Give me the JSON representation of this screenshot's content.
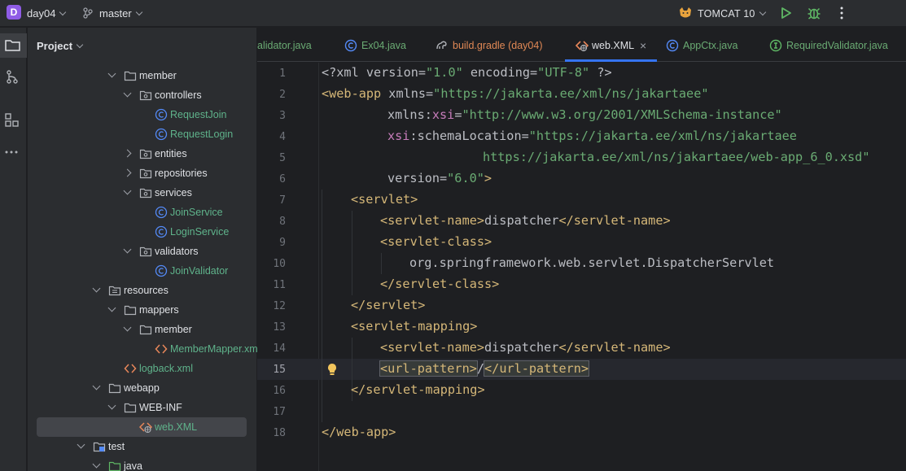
{
  "titlebar": {
    "project_badge": "D",
    "project_name": "day04",
    "branch": "master",
    "run_config": "TOMCAT 10"
  },
  "project_panel": {
    "header": "Project",
    "tree": [
      {
        "label": "member",
        "kind": "folder",
        "arrow": "down",
        "depth": 4
      },
      {
        "label": "controllers",
        "kind": "package",
        "arrow": "down",
        "depth": 5
      },
      {
        "label": "RequestJoin",
        "kind": "class",
        "depth": 6
      },
      {
        "label": "RequestLogin",
        "kind": "class",
        "depth": 6
      },
      {
        "label": "entities",
        "kind": "package",
        "arrow": "right",
        "depth": 5
      },
      {
        "label": "repositories",
        "kind": "package",
        "arrow": "right",
        "depth": 5
      },
      {
        "label": "services",
        "kind": "package",
        "arrow": "down",
        "depth": 5
      },
      {
        "label": "JoinService",
        "kind": "class",
        "depth": 6
      },
      {
        "label": "LoginService",
        "kind": "class",
        "depth": 6
      },
      {
        "label": "validators",
        "kind": "package",
        "arrow": "down",
        "depth": 5
      },
      {
        "label": "JoinValidator",
        "kind": "class",
        "depth": 6
      },
      {
        "label": "resources",
        "kind": "resources",
        "arrow": "down",
        "depth": 3
      },
      {
        "label": "mappers",
        "kind": "folder",
        "arrow": "down",
        "depth": 4
      },
      {
        "label": "member",
        "kind": "folder",
        "arrow": "down",
        "depth": 5
      },
      {
        "label": "MemberMapper.xml",
        "kind": "xml",
        "depth": 6
      },
      {
        "label": "logback.xml",
        "kind": "xml",
        "depth": 4
      },
      {
        "label": "webapp",
        "kind": "folder",
        "arrow": "down",
        "depth": 3
      },
      {
        "label": "WEB-INF",
        "kind": "folder",
        "arrow": "down",
        "depth": 4
      },
      {
        "label": "web.XML",
        "kind": "webxml",
        "depth": 5,
        "selected": true
      },
      {
        "label": "test",
        "kind": "test",
        "arrow": "down",
        "depth": 2
      },
      {
        "label": "java",
        "kind": "testjava",
        "arrow": "down",
        "depth": 3
      }
    ]
  },
  "tabs": [
    {
      "label": "alidator.java",
      "icon": "class-icon"
    },
    {
      "label": "Ex04.java",
      "icon": "class-icon"
    },
    {
      "label": "build.gradle (day04)",
      "icon": "gradle-icon"
    },
    {
      "label": "web.XML",
      "icon": "xml-icon",
      "active": true
    },
    {
      "label": "AppCtx.java",
      "icon": "class-icon"
    },
    {
      "label": "RequiredValidator.java",
      "icon": "interface-icon"
    }
  ],
  "tab_close_glyph": "×",
  "editor": {
    "current_line": 15,
    "lines": [
      {
        "n": "1"
      },
      {
        "n": "2"
      },
      {
        "n": "3"
      },
      {
        "n": "4"
      },
      {
        "n": "5"
      },
      {
        "n": "6"
      },
      {
        "n": "7"
      },
      {
        "n": "8"
      },
      {
        "n": "9"
      },
      {
        "n": "10"
      },
      {
        "n": "11"
      },
      {
        "n": "12"
      },
      {
        "n": "13"
      },
      {
        "n": "14"
      },
      {
        "n": "15"
      },
      {
        "n": "16"
      },
      {
        "n": "17"
      },
      {
        "n": "18"
      }
    ],
    "code": {
      "l1_a": "<?xml version=",
      "l1_b": "\"1.0\"",
      "l1_c": " encoding=",
      "l1_d": "\"UTF-8\"",
      "l1_e": " ?>",
      "l2_a": "<web-app",
      "l2_b": " xmlns=",
      "l2_c": "\"https://jakarta.ee/xml/ns/jakartaee\"",
      "l3_a": "xmlns:",
      "l3_b": "xsi",
      "l3_c": "=",
      "l3_d": "\"http://www.w3.org/2001/XMLSchema-instance\"",
      "l4_a": "xsi",
      "l4_b": ":schemaLocation=",
      "l4_c": "\"https://jakarta.ee/xml/ns/jakartaee",
      "l5_a": "https://jakarta.ee/xml/ns/jakartaee/web-app_6_0.xsd\"",
      "l6_a": "version=",
      "l6_b": "\"6.0\"",
      "l6_c": ">",
      "l7_a": "<servlet>",
      "l8_a": "<servlet-name>",
      "l8_b": "dispatcher",
      "l8_c": "</servlet-name>",
      "l9_a": "<servlet-class>",
      "l10_a": "org.springframework.web.servlet.DispatcherServlet",
      "l11_a": "</servlet-class>",
      "l12_a": "</servlet>",
      "l13_a": "<servlet-mapping>",
      "l14_a": "<servlet-name>",
      "l14_b": "dispatcher",
      "l14_c": "</servlet-name>",
      "l15_a": "<url-pattern>",
      "l15_b": "/",
      "l15_c": "</url-pattern>",
      "l16_a": "</servlet-mapping>",
      "l18_a": "</web-app>"
    }
  },
  "colors": {
    "accent": "#3574f0",
    "tag": "#d5b778",
    "string": "#6aab73",
    "namespace": "#c77dbb",
    "badge": "#8f5ce6"
  }
}
